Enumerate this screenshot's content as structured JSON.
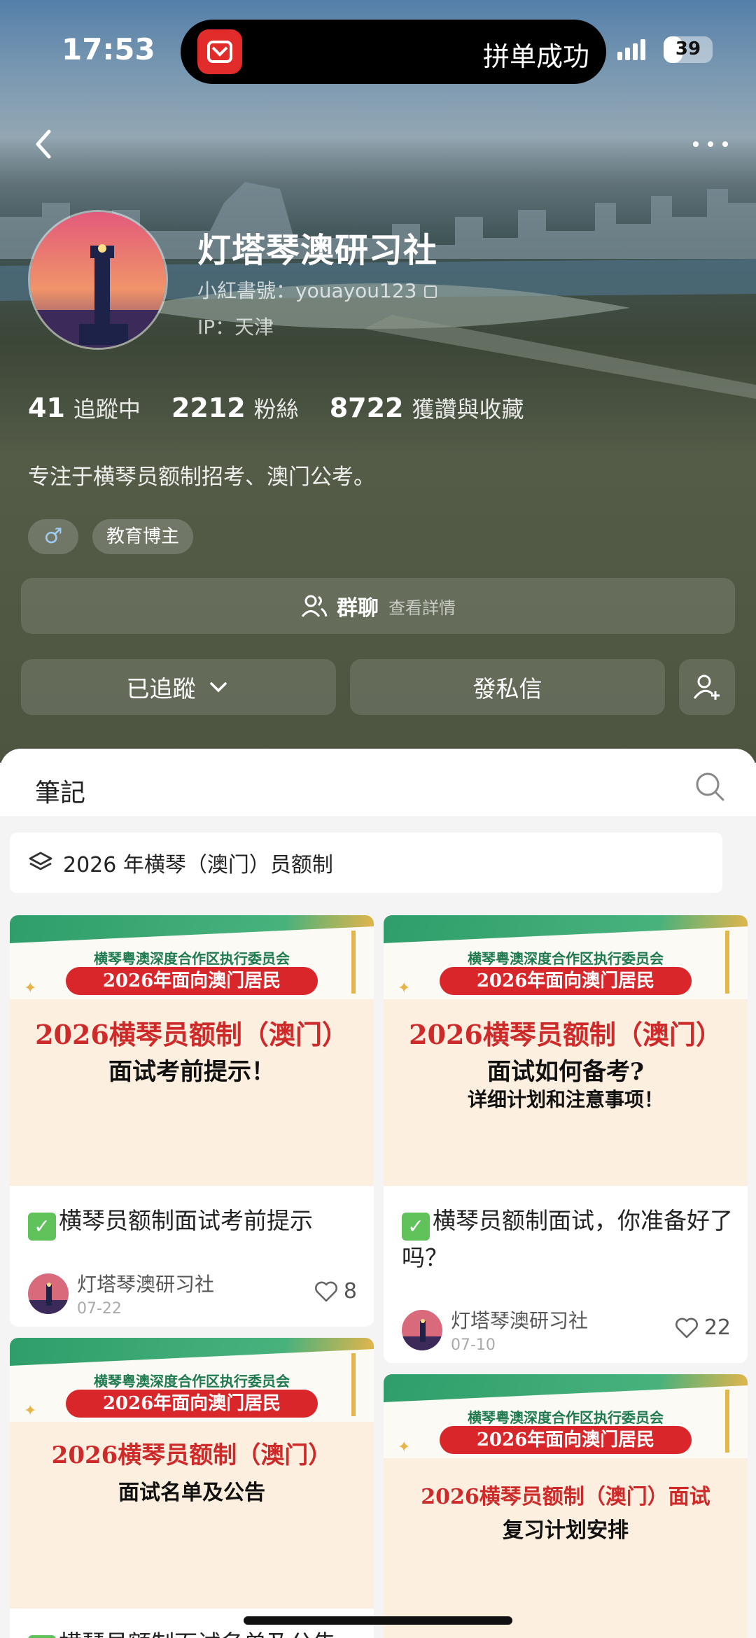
{
  "status_bar": {
    "time": "17:53",
    "island_text": "拼单成功",
    "battery": "39",
    "battery_level": 0.39
  },
  "profile": {
    "name": "灯塔琴澳研习社",
    "id_line": "小紅書號：youayou123",
    "ip_line": "IP：天津",
    "stats": [
      {
        "num": "41",
        "label": "追蹤中"
      },
      {
        "num": "2212",
        "label": "粉絲"
      },
      {
        "num": "8722",
        "label": "獲讚與收藏"
      }
    ],
    "bio": "专注于横琴员额制招考、澳门公考。",
    "tags": {
      "gender": "♂",
      "role": "教育博主"
    },
    "group_chat": {
      "label": "群聊",
      "sub": "查看詳情"
    },
    "buttons": {
      "follow": "已追蹤",
      "message": "發私信"
    }
  },
  "notes": {
    "tab_title": "筆記",
    "collection": "2026 年横琴（澳门）员额制",
    "cover_common": {
      "org": "横琴粤澳深度合作区执行委员会",
      "ribbon": "2026年面向澳门居民"
    },
    "cards": [
      {
        "cover_title": "2026横琴员额制（澳门）",
        "cover_sub": "面试考前提示！",
        "cover_sub2": "",
        "text": "横琴员额制面试考前提示",
        "author": "灯塔琴澳研习社",
        "date": "07-22",
        "likes": "8"
      },
      {
        "cover_title": "2026横琴员额制（澳门）",
        "cover_sub": "面试如何备考?",
        "cover_sub2": "详细计划和注意事项！",
        "text": "横琴员额制面试，你准备好了吗？",
        "author": "灯塔琴澳研习社",
        "date": "07-10",
        "likes": "22"
      },
      {
        "cover_title": "2026横琴员额制（澳门）",
        "cover_sub": "面试名单及公告",
        "cover_sub2": "",
        "text": "横琴员额制面试名单及公告"
      },
      {
        "cover_title": "2026横琴员额制（澳门）面试",
        "cover_sub": "复习计划安排",
        "cover_sub2": ""
      }
    ]
  }
}
